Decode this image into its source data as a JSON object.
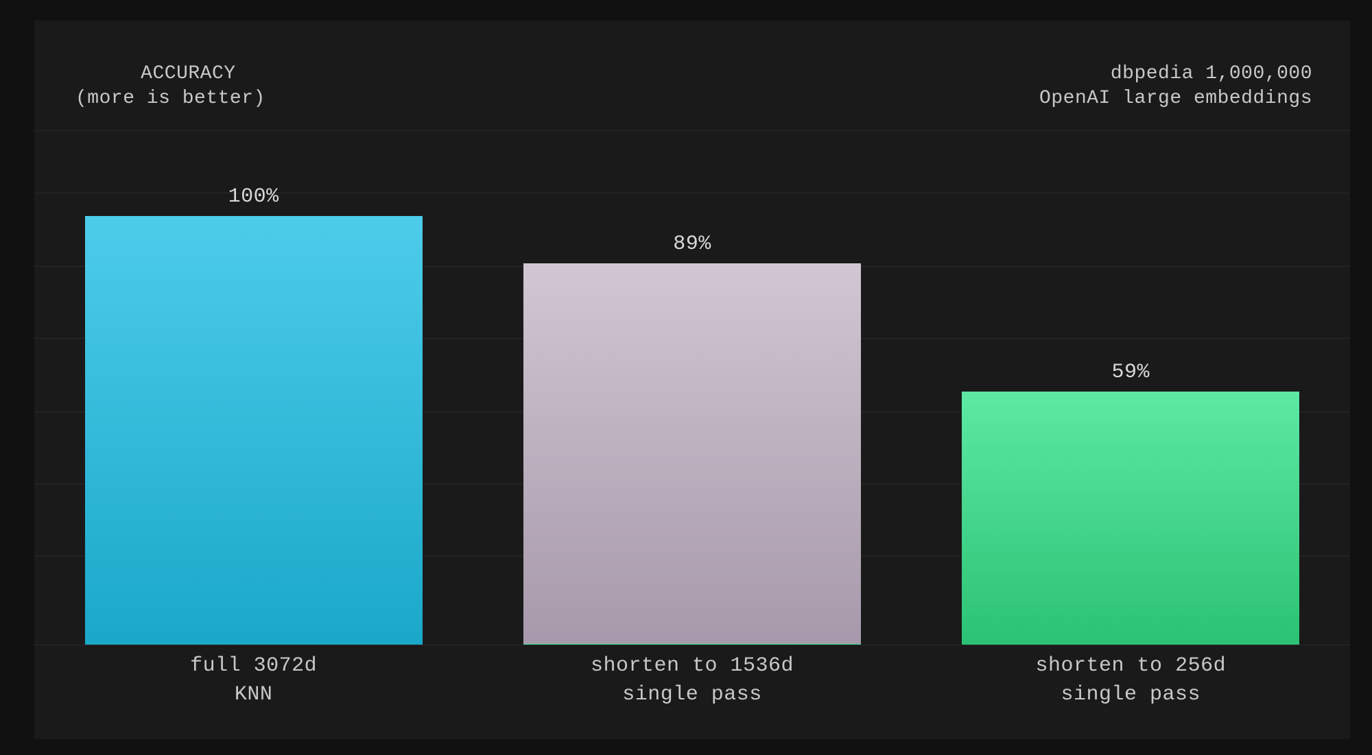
{
  "title_left": "   ACCURACY\n(more is better)",
  "title_right": "dbpedia 1,000,000\nOpenAI large embeddings",
  "chart_data": {
    "type": "bar",
    "title": "ACCURACY (more is better)",
    "subtitle": "dbpedia 1,000,000 — OpenAI large embeddings",
    "ylabel": "Accuracy",
    "ylim": [
      0,
      120
    ],
    "grid_positions_pct": [
      0,
      17.3,
      31.3,
      45.3,
      59.6,
      73.6,
      87.9,
      100
    ],
    "categories": [
      "full 3072d\nKNN",
      "shorten to 1536d\nsingle pass",
      "shorten to 256d\nsingle pass"
    ],
    "values": [
      100,
      89,
      59
    ],
    "value_labels": [
      "100%",
      "89%",
      "59%"
    ],
    "colors": [
      "#2bb9d9",
      "#bcaebf",
      "#3cd488"
    ]
  }
}
